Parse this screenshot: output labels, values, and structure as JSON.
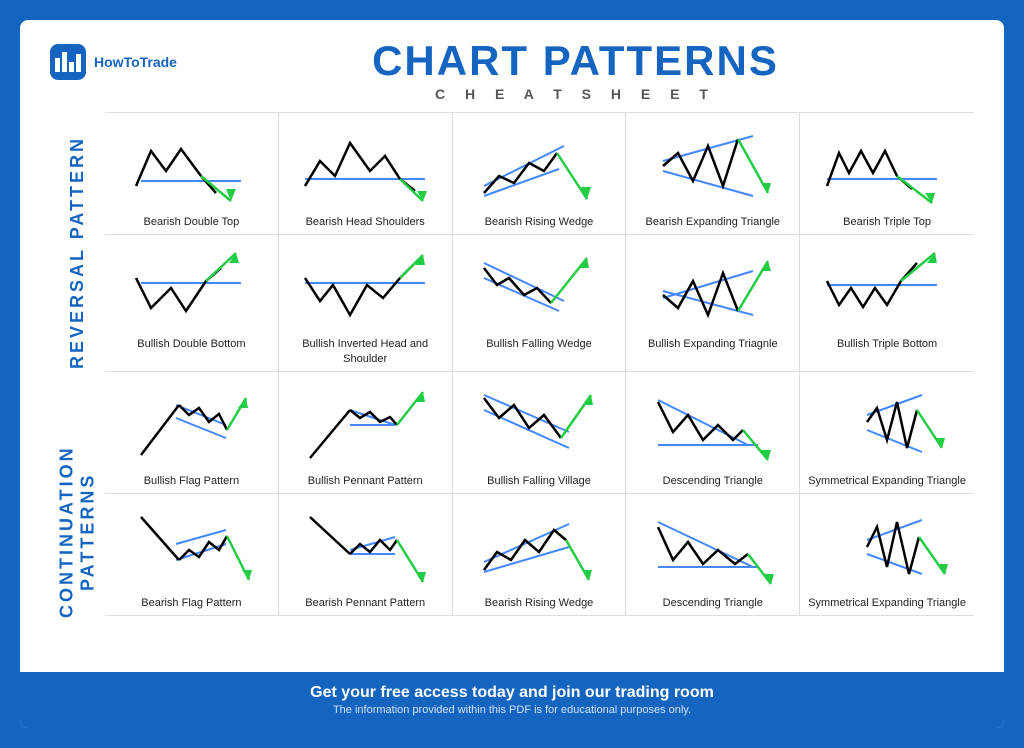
{
  "header": {
    "logo_text": "HowToTrade",
    "main_title": "CHART PATTERNS",
    "sub_title": "C H E A T   S H E E T"
  },
  "side_labels": {
    "reversal": "REVERSAL PATTERN",
    "continuation": "CONTINUATION PATTERNS"
  },
  "patterns": {
    "row1": [
      {
        "label": "Bearish Double Top"
      },
      {
        "label": "Bearish Head Shoulders"
      },
      {
        "label": "Bearish Rising Wedge"
      },
      {
        "label": "Bearish Expanding Triangle"
      },
      {
        "label": "Bearish Triple Top"
      }
    ],
    "row2": [
      {
        "label": "Bullish Double Bottom"
      },
      {
        "label": "Bullish Inverted Head and Shoulder"
      },
      {
        "label": "Bullish Falling Wedge"
      },
      {
        "label": "Bullish Expanding Triagnle"
      },
      {
        "label": "Bullish Triple Bottom"
      }
    ],
    "row3": [
      {
        "label": "Bullish Flag Pattern"
      },
      {
        "label": "Bullish Pennant Pattern"
      },
      {
        "label": "Bullish Falling Village"
      },
      {
        "label": "Descending Triangle"
      },
      {
        "label": "Symmetrical Expanding Triangle"
      }
    ],
    "row4": [
      {
        "label": "Bearish Flag Pattern"
      },
      {
        "label": "Bearish Pennant Pattern"
      },
      {
        "label": "Bearish Rising Wedge"
      },
      {
        "label": "Descending Triangle"
      },
      {
        "label": "Symmetrical Expanding Triangle"
      }
    ]
  },
  "footer": {
    "main": "Get your free access today and join our trading room",
    "sub": "The information provided within this PDF is for educational purposes only."
  }
}
